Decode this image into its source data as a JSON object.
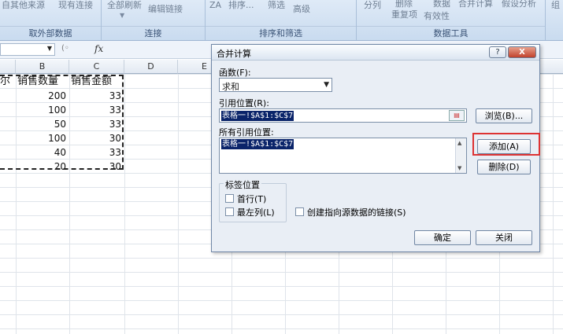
{
  "ribbon": {
    "top_texts": [
      "自其他来源",
      "现有连接",
      "全部刷新",
      "编辑链接",
      "排序...",
      "筛选",
      "高级",
      "分列",
      "删除",
      "数据",
      "合并计算",
      "假设分析",
      "组"
    ],
    "top_texts2": [
      "重复项",
      "有效性"
    ],
    "sort_icon": "ZA",
    "groups": [
      "取外部数据",
      "连接",
      "排序和筛选",
      "数据工具"
    ]
  },
  "formula_bar": {
    "fx": "fx"
  },
  "sheet": {
    "columns": [
      "B",
      "C",
      "D",
      "E"
    ],
    "header_row": [
      "销售数量",
      "销售金额"
    ],
    "left_fragment": "尔",
    "rows": [
      {
        "qty": "200",
        "amt": "33"
      },
      {
        "qty": "100",
        "amt": "33"
      },
      {
        "qty": "50",
        "amt": "33"
      },
      {
        "qty": "100",
        "amt": "30"
      },
      {
        "qty": "40",
        "amt": "33"
      },
      {
        "qty": "20",
        "amt": "30"
      }
    ]
  },
  "dialog": {
    "title": "合并计算",
    "help_btn": "?",
    "close_btn": "X",
    "function_label": "函数(F):",
    "function_value": "求和",
    "ref_label": "引用位置(R):",
    "ref_value": "表格一!$A$1:$C$7",
    "browse_btn": "浏览(B)...",
    "all_refs_label": "所有引用位置:",
    "all_refs": [
      "表格一!$A$1:$C$7"
    ],
    "add_btn": "添加(A)",
    "delete_btn": "删除(D)",
    "label_pos_title": "标签位置",
    "top_row": "首行(T)",
    "left_col": "最左列(L)",
    "create_links": "创建指向源数据的链接(S)",
    "ok_btn": "确定",
    "close_btn_label": "关闭"
  },
  "colors": {
    "highlight_box": "#dd3333",
    "selection": "#0a246a"
  }
}
